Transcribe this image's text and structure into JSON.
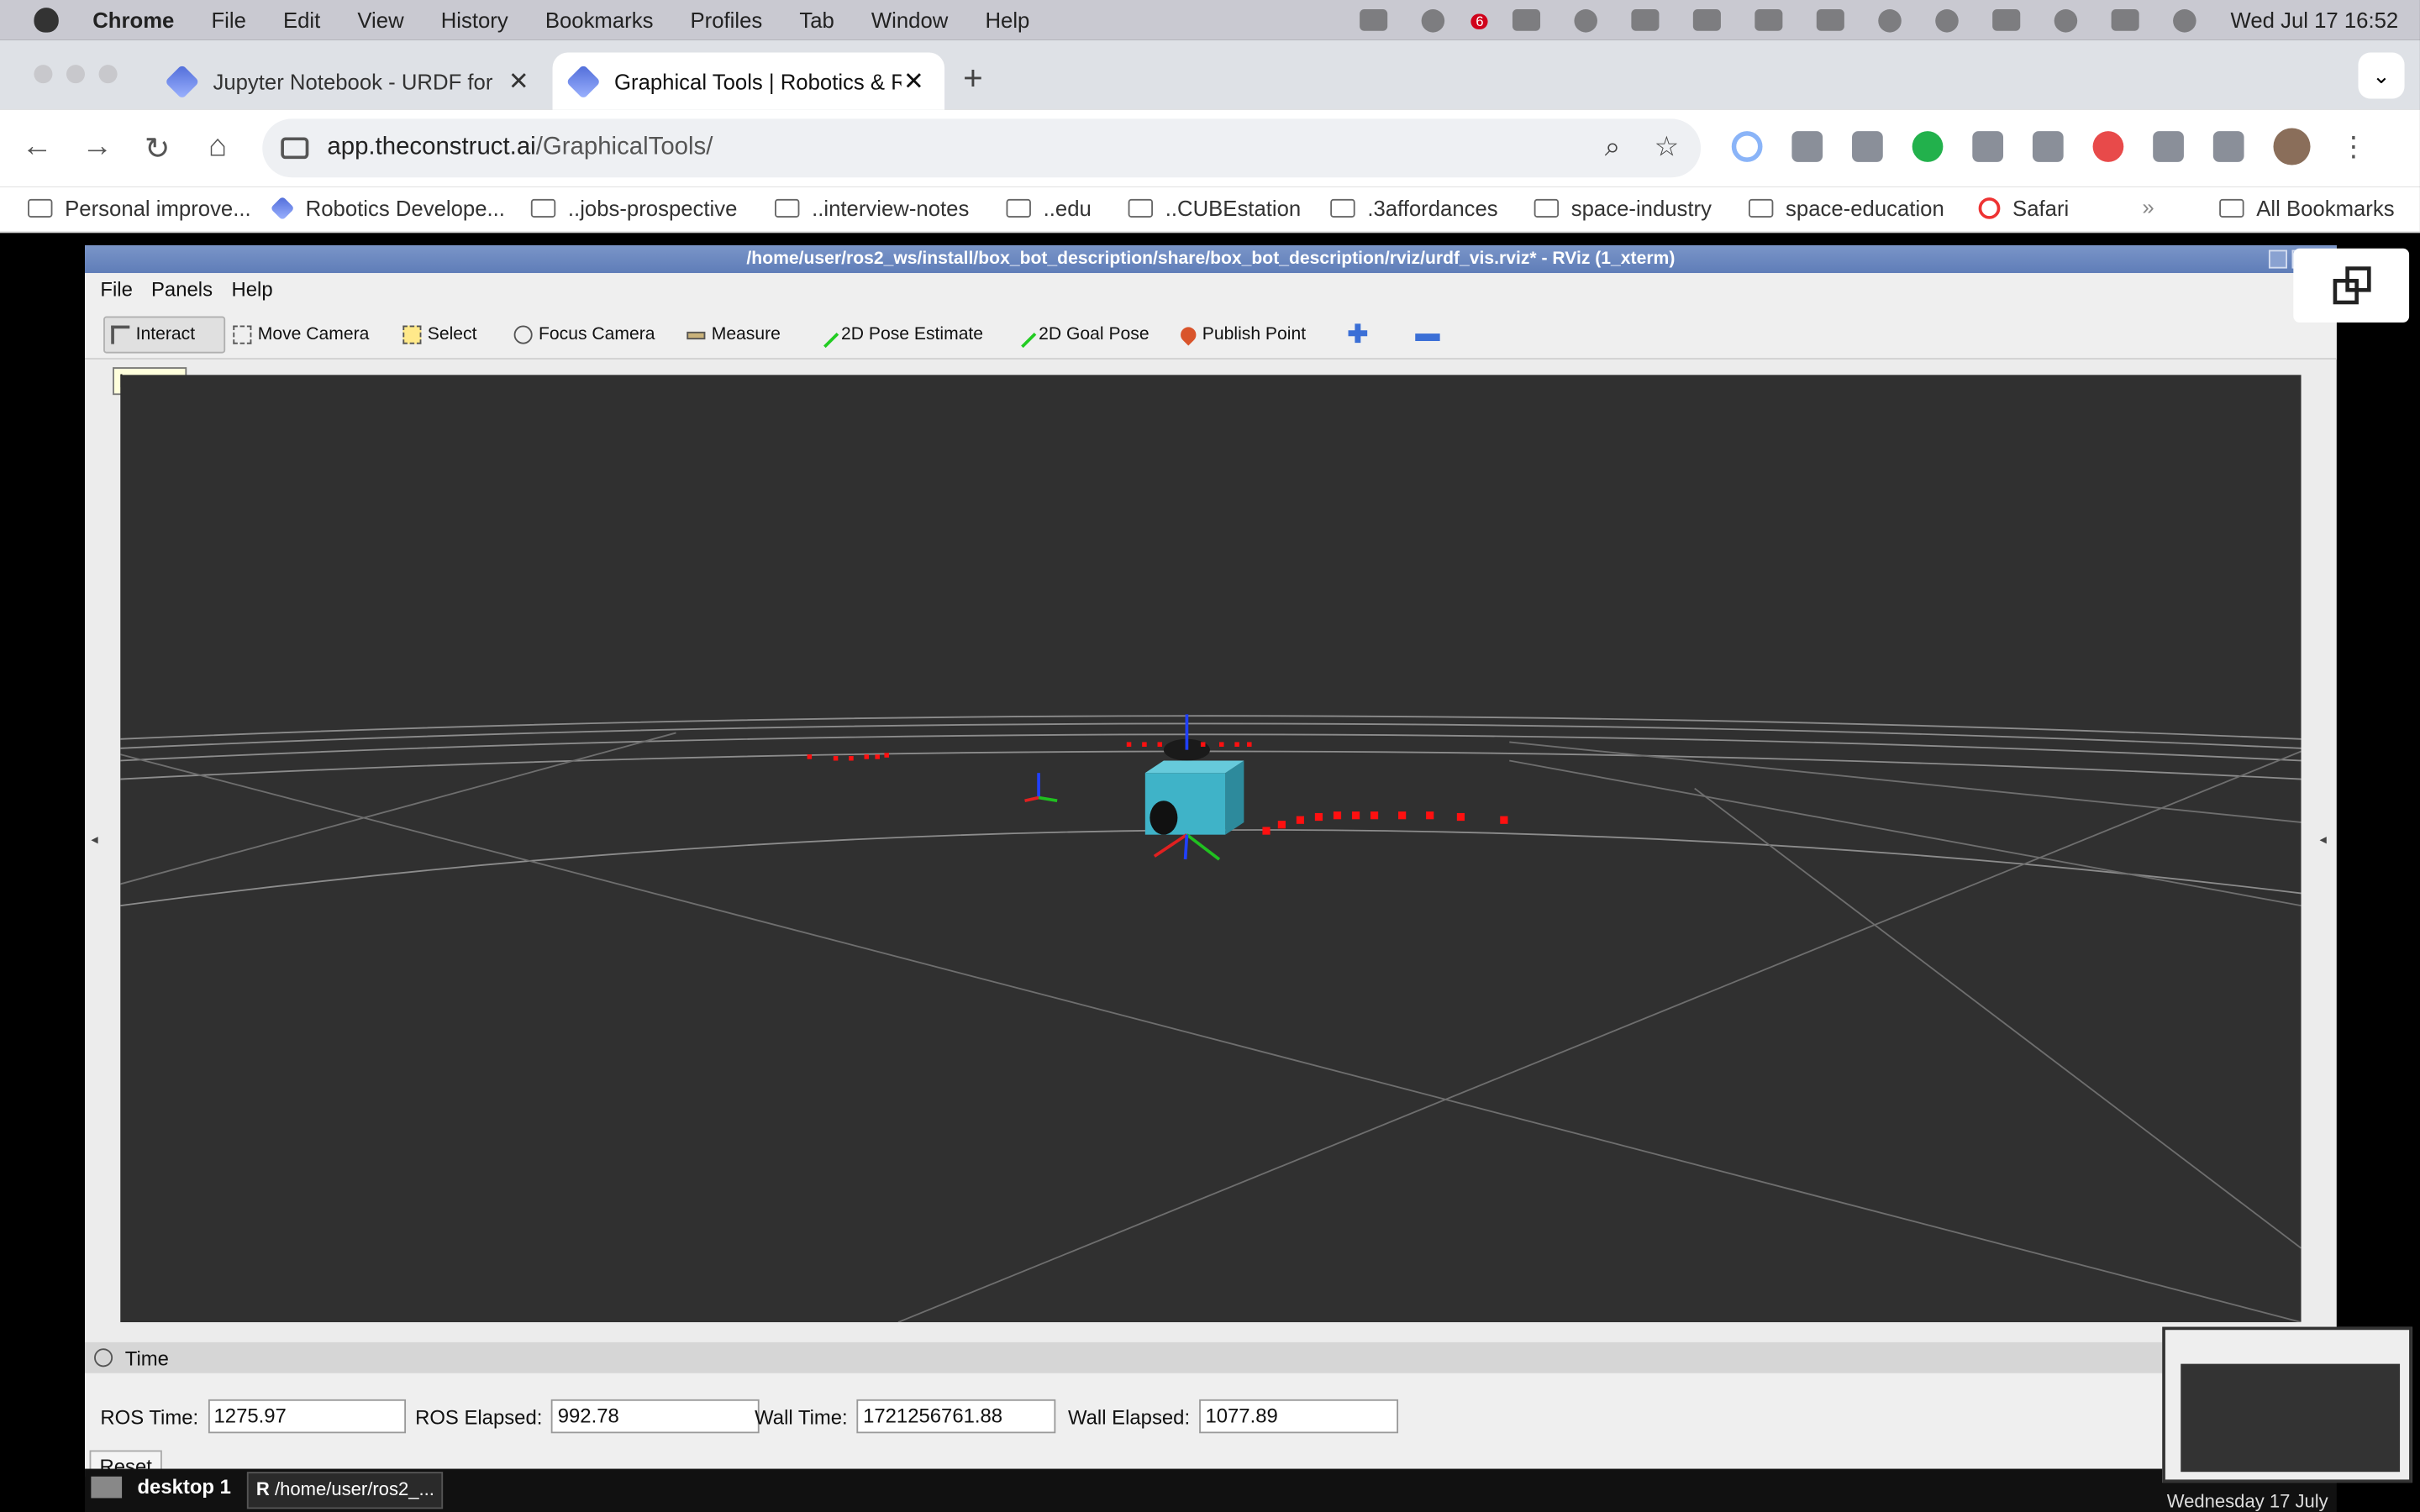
{
  "mac_menu": {
    "app": "Chrome",
    "items": [
      "File",
      "Edit",
      "View",
      "History",
      "Bookmarks",
      "Profiles",
      "Tab",
      "Window",
      "Help"
    ],
    "notification_count": "6",
    "clock": "Wed Jul 17  16:52"
  },
  "tabs": [
    {
      "title": "Jupyter Notebook - URDF for"
    },
    {
      "title": "Graphical Tools | Robotics & R"
    }
  ],
  "address": {
    "host": "app.theconstruct.ai",
    "path": "/GraphicalTools/"
  },
  "bookmarks": [
    "Personal improve...",
    "Robotics Develope...",
    "..jobs-prospective",
    "..interview-notes",
    "..edu",
    "..CUBEstation",
    ".3affordances",
    "space-industry",
    "space-education",
    "Safari"
  ],
  "all_bookmarks": "All Bookmarks",
  "rviz": {
    "title": "/home/user/ros2_ws/install/box_bot_description/share/box_bot_description/rviz/urdf_vis.rviz* - RViz (1_xterm)",
    "menu": [
      "File",
      "Panels",
      "Help"
    ],
    "tools": [
      "Interact",
      "Move Camera",
      "Select",
      "Focus Camera",
      "Measure",
      "2D Pose Estimate",
      "2D Goal Pose",
      "Publish Point"
    ],
    "tooltip": "Interact",
    "time_panel": {
      "header": "Time",
      "ros_time_label": "ROS Time:",
      "ros_time": "1275.97",
      "ros_elapsed_label": "ROS Elapsed:",
      "ros_elapsed": "992.78",
      "wall_time_label": "Wall Time:",
      "wall_time": "1721256761.88",
      "wall_elapsed_label": "Wall Elapsed:",
      "wall_elapsed": "1077.89",
      "reset": "Reset"
    }
  },
  "taskbar": {
    "desktop": "desktop 1",
    "task": "/home/user/ros2_..."
  },
  "thumbnail_date": "Wednesday 17 July",
  "colors": {
    "grid_bg": "#303030",
    "grid_line": "#a0a0a0",
    "robot": "#3fb3c8",
    "laser": "#ff1010"
  }
}
